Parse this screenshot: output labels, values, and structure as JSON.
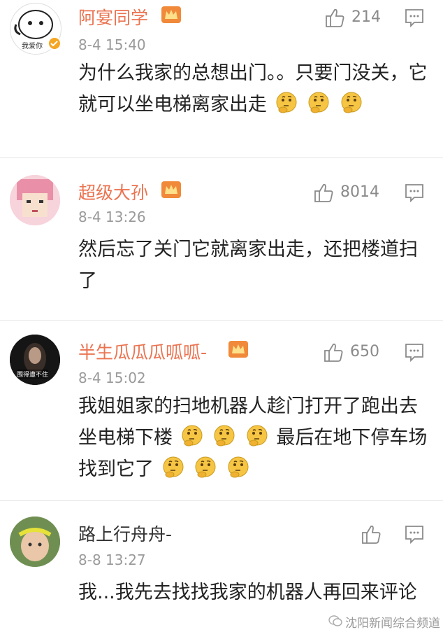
{
  "comments": [
    {
      "name": "阿宴同学",
      "avatar_text": "我爱你",
      "time": "8-4 15:40",
      "likes": "214",
      "segments": [
        {
          "text": "为什么我家的总想出门。。只要门没关，它就可以坐电梯离家出走"
        }
      ],
      "emoji_after": 3
    },
    {
      "name": "超级大孙",
      "time": "8-4 13:26",
      "likes": "8014",
      "segments": [
        {
          "text": "然后忘了关门它就离家出走，还把楼道扫了"
        }
      ]
    },
    {
      "name": "半生瓜瓜瓜呱呱-",
      "avatar_text": "围得遭不住",
      "time": "8-4 15:02",
      "likes": "650",
      "text_a": "我姐姐家的扫地机器人趁门打开了跑出去坐电梯下楼",
      "text_b": "最后在地下停车场找到它了"
    },
    {
      "name": "路上行舟舟-",
      "time": "8-8 13:27",
      "likes": "",
      "segments": [
        {
          "text": "我...我先去找找我家的机器人再回来评论"
        }
      ]
    }
  ],
  "watermark": "沈阳新闻综合频道",
  "colors": {
    "name": "#eb7350",
    "plain_name": "#333333",
    "time": "#9a9a9a",
    "emoji": "#f6c544"
  },
  "icons": {
    "like": "thumbs-up-icon",
    "reply": "comment-icon",
    "badge": "vip-crown-icon",
    "emoji": "thinking-face-emoji"
  }
}
